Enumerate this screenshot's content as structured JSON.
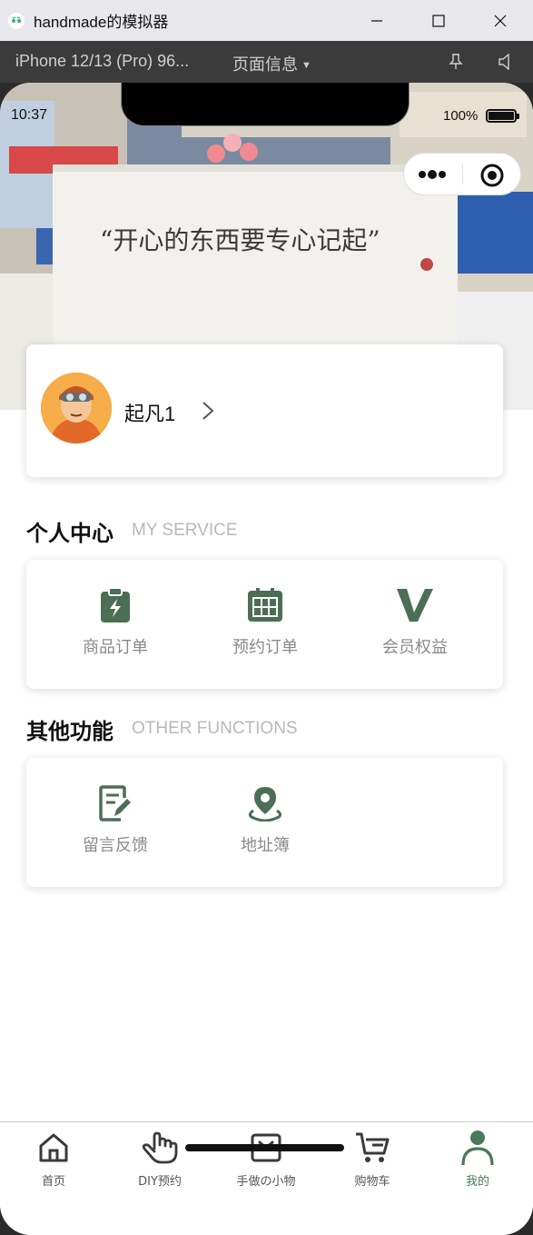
{
  "window": {
    "title": "handmade的模拟器",
    "device": "iPhone 12/13 (Pro) 96...",
    "page_info": "页面信息"
  },
  "status": {
    "time": "10:37",
    "battery": "100%"
  },
  "banner": {
    "caption": "“开心的东西要专心记起”"
  },
  "profile": {
    "name": "起凡1"
  },
  "service": {
    "title": "个人中心",
    "subtitle": "MY SERVICE",
    "items": [
      {
        "label": "商品订单",
        "icon": "clipboard-bolt-icon"
      },
      {
        "label": "预约订单",
        "icon": "calendar-icon"
      },
      {
        "label": "会员权益",
        "icon": "v-icon"
      }
    ]
  },
  "other": {
    "title": "其他功能",
    "subtitle": "OTHER FUNCTIONS",
    "items": [
      {
        "label": "留言反馈",
        "icon": "note-edit-icon"
      },
      {
        "label": "地址簿",
        "icon": "location-pin-icon"
      }
    ]
  },
  "tabbar": {
    "items": [
      {
        "label": "首页",
        "icon": "home-icon"
      },
      {
        "label": "DIY预约",
        "icon": "hand-icon"
      },
      {
        "label": "手做の小物",
        "icon": "bag-icon"
      },
      {
        "label": "购物车",
        "icon": "cart-icon"
      },
      {
        "label": "我的",
        "icon": "user-icon",
        "active": true
      }
    ]
  },
  "colors": {
    "accent": "#4a7a5a",
    "icon_green": "#4c6e55"
  }
}
